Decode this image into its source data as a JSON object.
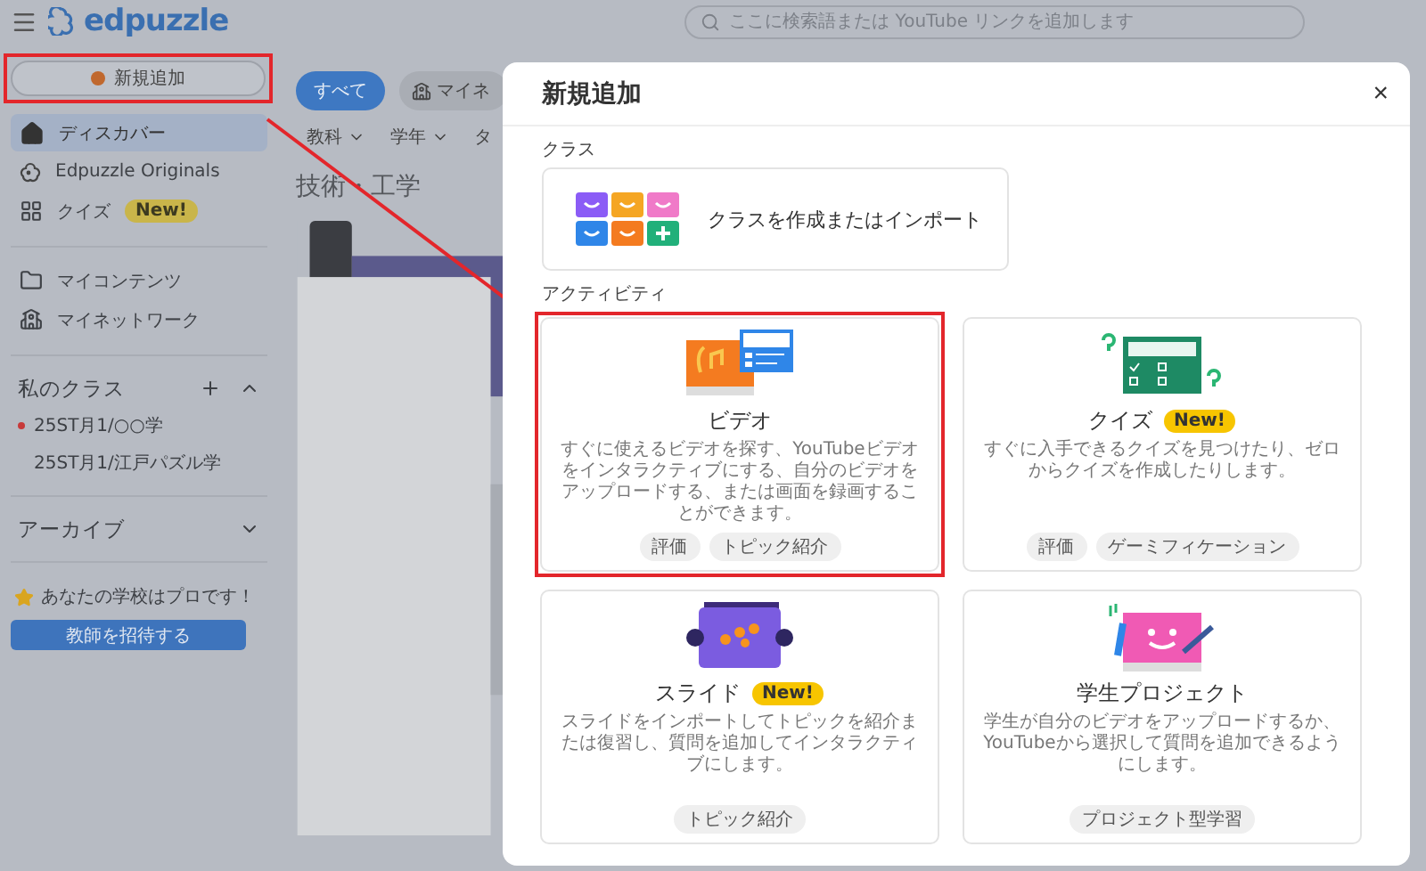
{
  "header": {
    "logo": "edpuzzle",
    "search": {
      "placeholder": "ここに検索語または YouTube リンクを追加します"
    }
  },
  "sidebar": {
    "new_button": {
      "label": "新規追加",
      "highlighted": true
    },
    "nav": [
      {
        "kind": "home",
        "label": "ディスカバー",
        "selected": true
      },
      {
        "kind": "originals",
        "label": "Edpuzzle Originals",
        "selected": false
      },
      {
        "kind": "grid",
        "label": "クイズ",
        "badge": "New!",
        "selected": false
      }
    ],
    "nav2": [
      {
        "kind": "folder",
        "label": "マイコンテンツ"
      },
      {
        "kind": "school",
        "label": "マイネットワーク"
      }
    ],
    "classes": {
      "title": "私のクラス",
      "expanded": true,
      "items": [
        {
          "label": "25ST月1/○○学",
          "dot": true
        },
        {
          "label": "25ST月1/江戸パズル学",
          "dot": false
        }
      ]
    },
    "archive": {
      "title": "アーカイブ",
      "expanded": false
    },
    "promo": {
      "text": "あなたの学校はプロです！",
      "button": "教師を招待する"
    }
  },
  "main": {
    "filters": [
      {
        "label": "すべて",
        "selected": true
      },
      {
        "label": "マイネ",
        "selected": false
      }
    ],
    "dropdowns": [
      "教科",
      "学年",
      "タ"
    ],
    "section_title": "技術・工学"
  },
  "modal": {
    "title": "新規追加",
    "close": "×",
    "class_section": {
      "label": "クラス",
      "card": "クラスを作成またはインポート"
    },
    "activity_label": "アクティビティ",
    "activities": [
      {
        "kind": "video",
        "title": "ビデオ",
        "highlighted": true,
        "description": "すぐに使えるビデオを探す、YouTubeビデオをインタラクティブにする、自分のビデオをアップロードする、または画面を録画することができます。",
        "tags": [
          "評価",
          "トピック紹介"
        ]
      },
      {
        "kind": "quiz",
        "title": "クイズ",
        "badge": "New!",
        "highlighted": false,
        "description": "すぐに入手できるクイズを見つけたり、ゼロからクイズを作成したりします。",
        "tags": [
          "評価",
          "ゲーミフィケーション"
        ]
      },
      {
        "kind": "slides",
        "title": "スライド",
        "badge": "New!",
        "highlighted": false,
        "description": "スライドをインポートしてトピックを紹介または復習し、質問を追加してインタラクティブにします。",
        "tags": [
          "トピック紹介"
        ]
      },
      {
        "kind": "project",
        "title": "学生プロジェクト",
        "highlighted": false,
        "description": "学生が自分のビデオをアップロードするか、YouTubeから選択して質問を追加できるようにします。",
        "tags": [
          "プロジェクト型学習"
        ]
      }
    ]
  }
}
